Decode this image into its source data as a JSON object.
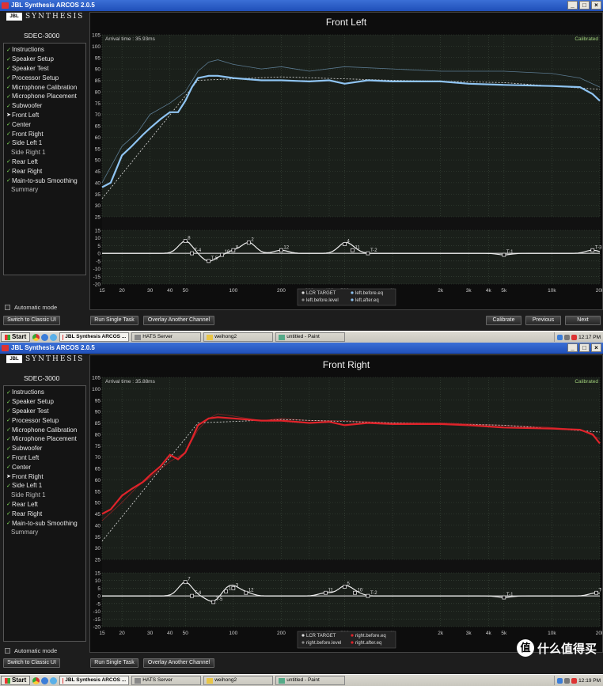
{
  "windows": [
    {
      "title": "JBL Synthesis ARCOS 2.0.5",
      "logo_text": "SYNTHESIS",
      "logo_badge": "JBL",
      "model": "SDEC-3000",
      "nav_items": [
        {
          "label": "Instructions",
          "state": "done"
        },
        {
          "label": "Speaker Setup",
          "state": "done"
        },
        {
          "label": "Speaker Test",
          "state": "done"
        },
        {
          "label": "Processor Setup",
          "state": "done"
        },
        {
          "label": "Microphone Calibration",
          "state": "done"
        },
        {
          "label": "Microphone Placement",
          "state": "done"
        },
        {
          "label": "Subwoofer",
          "state": "done"
        },
        {
          "label": "Front Left",
          "state": "current"
        },
        {
          "label": "Center",
          "state": "done"
        },
        {
          "label": "Front Right",
          "state": "done"
        },
        {
          "label": "Side Left 1",
          "state": "done"
        },
        {
          "label": "Side Right 1",
          "state": "pending"
        },
        {
          "label": "Rear Left",
          "state": "done"
        },
        {
          "label": "Rear Right",
          "state": "done"
        },
        {
          "label": "Main-to-sub Smoothing",
          "state": "done"
        },
        {
          "label": "Summary",
          "state": "pending"
        }
      ],
      "automatic_mode_label": "Automatic mode",
      "buttons": {
        "classic": "Switch to Classic UI",
        "single_task": "Run Single Task",
        "overlay": "Overlay Another Channel",
        "calibrate": "Calibrate",
        "previous": "Previous",
        "next": "Next"
      },
      "panel_title": "Front Left",
      "arrival_time": "Arrival time : 35.93ms",
      "status": "Calibrated",
      "legend": [
        "LCR TARGET",
        "left.before.eq",
        "left.before.level",
        "left.after.eq"
      ],
      "curve_color": "#8fc4f2",
      "taskbar": {
        "start": "Start",
        "tasks": [
          "JBL Synthesis ARCOS ...",
          "HATS Server",
          "weihong2",
          "untitled - Paint"
        ],
        "clock": "12:17 PM"
      },
      "chart_data": {
        "type": "line",
        "xscale": "log",
        "xlim": [
          15,
          20000
        ],
        "xticks": [
          "15",
          "20",
          "30",
          "40",
          "50",
          "100",
          "200",
          "300",
          "400",
          "500",
          "1k",
          "2k",
          "3k",
          "4k",
          "5k",
          "10k",
          "20k"
        ],
        "upper_ylim": [
          25,
          105
        ],
        "upper_yticks": [
          "105",
          "100",
          "95",
          "90",
          "85",
          "80",
          "75",
          "70",
          "65",
          "60",
          "55",
          "50",
          "45",
          "40",
          "35",
          "30",
          "25"
        ],
        "lower_ylim": [
          -20,
          15
        ],
        "lower_yticks": [
          "15",
          "10",
          "5",
          "0",
          "-5",
          "-10",
          "-15",
          "-20"
        ],
        "series": [
          {
            "name": "left.after.eq",
            "x": [
              15,
              17,
              20,
              23,
              27,
              30,
              35,
              40,
              45,
              50,
              55,
              60,
              70,
              80,
              100,
              150,
              200,
              300,
              400,
              500,
              700,
              1000,
              2000,
              3000,
              5000,
              10000,
              15000,
              18000,
              20000
            ],
            "y": [
              38,
              40,
              52,
              56,
              61,
              64,
              68,
              71,
              71,
              76,
              82,
              86,
              87,
              87,
              86,
              85,
              85,
              84.5,
              85,
              83.5,
              85,
              84.5,
              84.5,
              83.5,
              83,
              82.5,
              82,
              79,
              76
            ]
          },
          {
            "name": "left.before.eq",
            "x": [
              15,
              20,
              25,
              30,
              40,
              50,
              60,
              70,
              80,
              100,
              150,
              200,
              300,
              500,
              1000,
              2000,
              5000,
              10000,
              15000,
              20000
            ],
            "y": [
              40,
              56,
              62,
              70,
              75,
              80,
              89,
              93,
              94,
              92,
              90,
              91,
              89,
              91,
              90,
              89,
              89,
              88,
              86,
              82
            ]
          },
          {
            "name": "LCR TARGET",
            "x": [
              15,
              60,
              200,
              1000,
              5000,
              20000
            ],
            "y": [
              33,
              85,
              86.5,
              85,
              84,
              81
            ]
          }
        ],
        "eq_filters": [
          {
            "label": "8",
            "x": 50,
            "gain": 8
          },
          {
            "label": "T-4",
            "x": 55,
            "gain": 0
          },
          {
            "label": "T-5",
            "x": 70,
            "gain": -5
          },
          {
            "label": "10",
            "x": 85,
            "gain": -1
          },
          {
            "label": "9",
            "x": 100,
            "gain": 2
          },
          {
            "label": "2",
            "x": 125,
            "gain": 7
          },
          {
            "label": "12",
            "x": 200,
            "gain": 2
          },
          {
            "label": "4",
            "x": 500,
            "gain": 6
          },
          {
            "label": "11",
            "x": 560,
            "gain": 2
          },
          {
            "label": "T-2",
            "x": 700,
            "gain": 0
          },
          {
            "label": "T-1",
            "x": 5000,
            "gain": -1
          },
          {
            "label": "T-3",
            "x": 18000,
            "gain": 2
          }
        ]
      }
    },
    {
      "title": "JBL Synthesis ARCOS 2.0.5",
      "logo_text": "SYNTHESIS",
      "logo_badge": "JBL",
      "model": "SDEC-3000",
      "nav_items": [
        {
          "label": "Instructions",
          "state": "done"
        },
        {
          "label": "Speaker Setup",
          "state": "done"
        },
        {
          "label": "Speaker Test",
          "state": "done"
        },
        {
          "label": "Processor Setup",
          "state": "done"
        },
        {
          "label": "Microphone Calibration",
          "state": "done"
        },
        {
          "label": "Microphone Placement",
          "state": "done"
        },
        {
          "label": "Subwoofer",
          "state": "done"
        },
        {
          "label": "Front Left",
          "state": "done"
        },
        {
          "label": "Center",
          "state": "done"
        },
        {
          "label": "Front Right",
          "state": "current"
        },
        {
          "label": "Side Left 1",
          "state": "done"
        },
        {
          "label": "Side Right 1",
          "state": "pending"
        },
        {
          "label": "Rear Left",
          "state": "done"
        },
        {
          "label": "Rear Right",
          "state": "done"
        },
        {
          "label": "Main-to-sub Smoothing",
          "state": "done"
        },
        {
          "label": "Summary",
          "state": "pending"
        }
      ],
      "automatic_mode_label": "Automatic mode",
      "buttons": {
        "classic": "Switch to Classic UI",
        "single_task": "Run Single Task",
        "overlay": "Overlay Another Channel"
      },
      "panel_title": "Front Right",
      "arrival_time": "Arrival time : 35.88ms",
      "status": "Calibrated",
      "legend": [
        "LCR TARGET",
        "right.before.eq",
        "right.before.level",
        "right.after.eq"
      ],
      "curve_color": "#e0232a",
      "taskbar": {
        "start": "Start",
        "tasks": [
          "JBL Synthesis ARCOS ...",
          "HATS Server",
          "weihong2",
          "untitled - Paint"
        ],
        "clock": "12:19 PM"
      },
      "watermark": "什么值得买",
      "watermark_icon": "值",
      "chart_data": {
        "type": "line",
        "xscale": "log",
        "xlim": [
          15,
          20000
        ],
        "xticks": [
          "15",
          "20",
          "30",
          "40",
          "50",
          "100",
          "200",
          "300",
          "400",
          "500",
          "1k",
          "2k",
          "3k",
          "4k",
          "5k",
          "10k",
          "20k"
        ],
        "upper_ylim": [
          25,
          105
        ],
        "upper_yticks": [
          "105",
          "100",
          "95",
          "90",
          "85",
          "80",
          "75",
          "70",
          "65",
          "60",
          "55",
          "50",
          "45",
          "40",
          "35",
          "30",
          "25"
        ],
        "lower_ylim": [
          -20,
          15
        ],
        "lower_yticks": [
          "15",
          "10",
          "5",
          "0",
          "-5",
          "-10",
          "-15",
          "-20"
        ],
        "series": [
          {
            "name": "right.after.eq",
            "x": [
              15,
              17,
              20,
              23,
              27,
              30,
              35,
              40,
              45,
              50,
              55,
              60,
              70,
              80,
              100,
              150,
              200,
              300,
              400,
              500,
              700,
              1000,
              2000,
              3000,
              5000,
              10000,
              15000,
              18000,
              20000
            ],
            "y": [
              45,
              47,
              53,
              56,
              59,
              62,
              66,
              71,
              69,
              72,
              78,
              84,
              87,
              87.5,
              87,
              86,
              86,
              85,
              85.5,
              84,
              85,
              84.5,
              84.5,
              84,
              83,
              82.5,
              82,
              80,
              76
            ]
          },
          {
            "name": "right.before.eq",
            "x": [
              15,
              20,
              25,
              30,
              40,
              50,
              60,
              70,
              80,
              100,
              150,
              200,
              300,
              500,
              1000,
              2000,
              5000,
              10000,
              15000,
              20000
            ],
            "y": [
              42,
              50,
              57,
              61,
              68,
              72,
              82,
              87,
              89,
              88,
              86,
              87,
              86,
              86,
              85,
              85,
              84,
              83,
              82,
              78
            ]
          },
          {
            "name": "LCR TARGET",
            "x": [
              15,
              60,
              200,
              1000,
              5000,
              20000
            ],
            "y": [
              33,
              85,
              86.5,
              85,
              84,
              81
            ]
          }
        ],
        "eq_filters": [
          {
            "label": "7",
            "x": 50,
            "gain": 9
          },
          {
            "label": "T-4",
            "x": 55,
            "gain": 0
          },
          {
            "label": "T-5",
            "x": 75,
            "gain": -4
          },
          {
            "label": "1",
            "x": 90,
            "gain": 3
          },
          {
            "label": "3",
            "x": 100,
            "gain": 5
          },
          {
            "label": "12",
            "x": 120,
            "gain": 2
          },
          {
            "label": "11",
            "x": 380,
            "gain": 2
          },
          {
            "label": "5",
            "x": 500,
            "gain": 6
          },
          {
            "label": "10",
            "x": 580,
            "gain": 2
          },
          {
            "label": "T-2",
            "x": 700,
            "gain": 0
          },
          {
            "label": "T-1",
            "x": 5000,
            "gain": -1
          },
          {
            "label": "T-3",
            "x": 19000,
            "gain": 2
          }
        ]
      }
    }
  ]
}
